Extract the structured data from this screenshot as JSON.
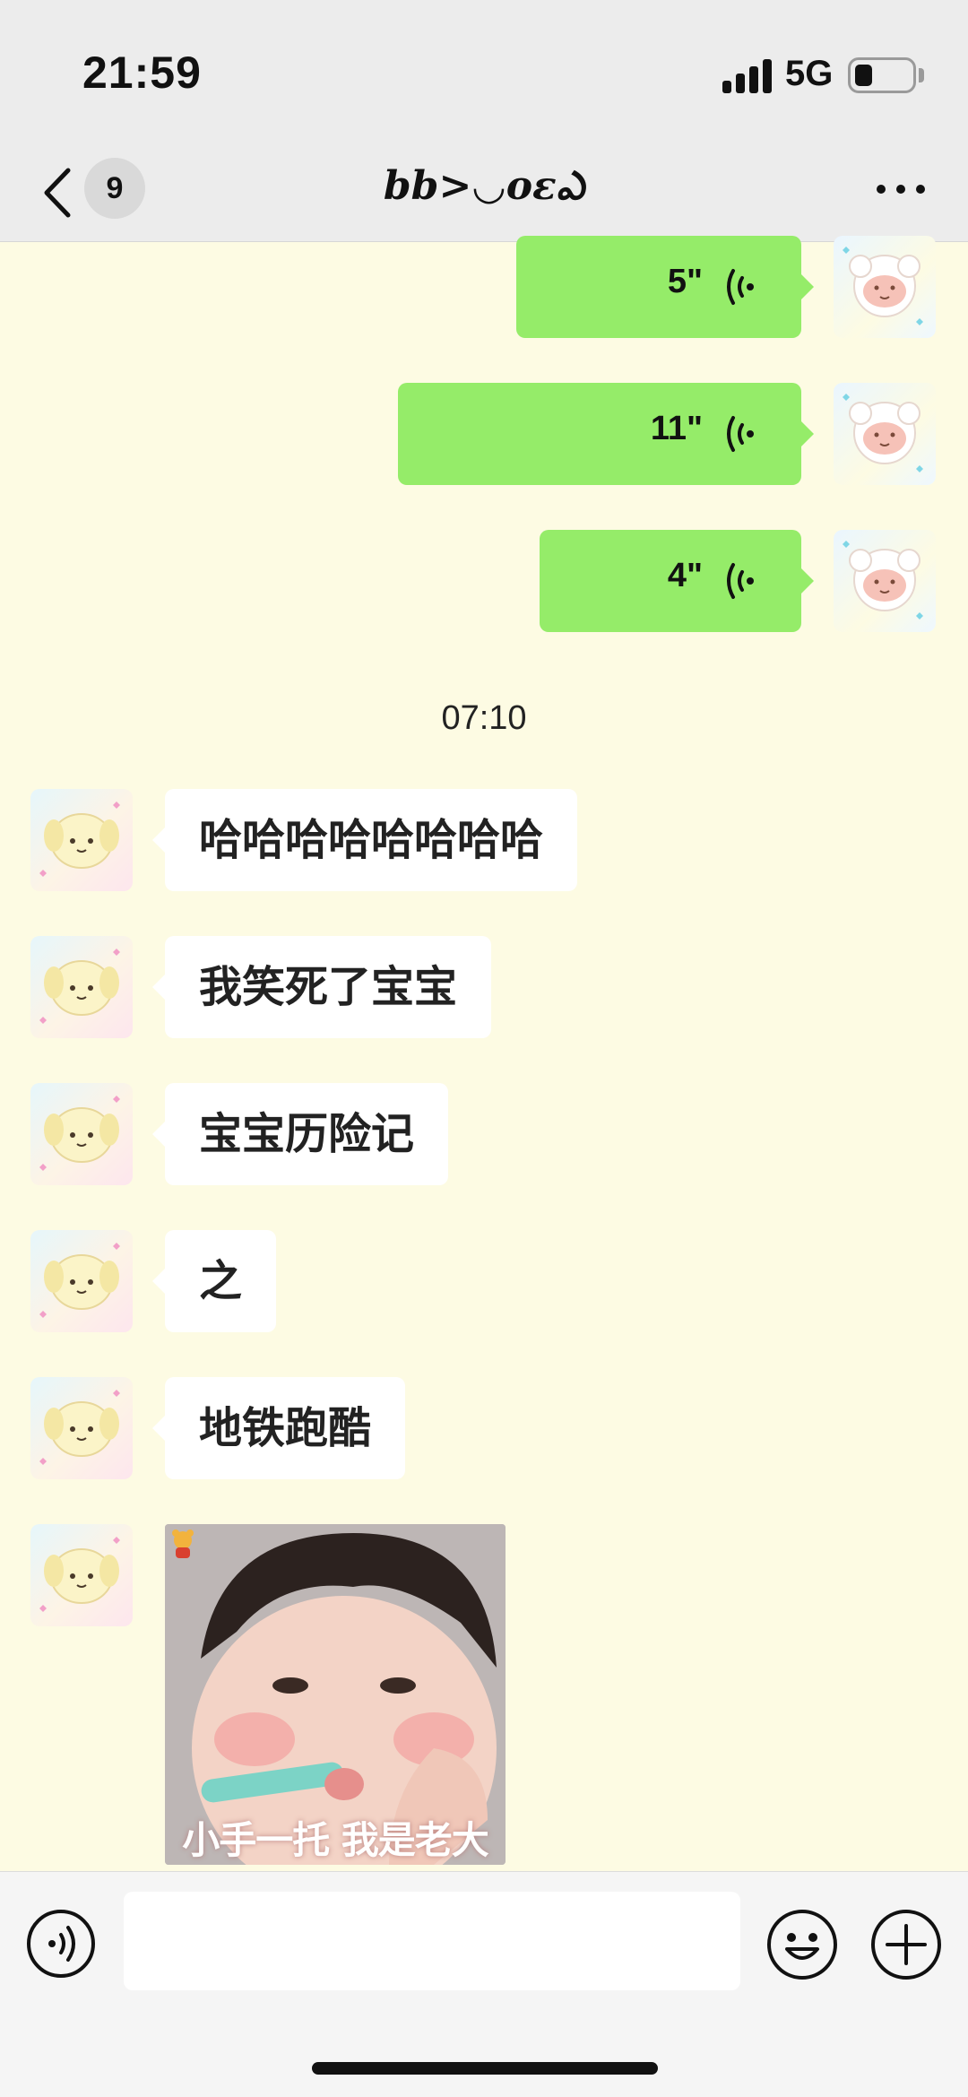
{
  "status_bar": {
    "time": "21:59",
    "network": "5G",
    "battery_level": 0.3
  },
  "nav": {
    "unread_count": "9",
    "title": "bb>◡oεఎ"
  },
  "messages": {
    "voice": [
      {
        "duration": "5\""
      },
      {
        "duration": "11\""
      },
      {
        "duration": "4\""
      }
    ],
    "timestamp": "07:10",
    "texts": [
      {
        "text": "哈哈哈哈哈哈哈哈"
      },
      {
        "text": "我笑死了宝宝"
      },
      {
        "text": "宝宝历险记"
      },
      {
        "text": "之"
      },
      {
        "text": "地铁跑酷"
      }
    ],
    "image_caption": "小手一托 我是老大"
  },
  "icons": {
    "back": "chevron-left-icon",
    "more": "more-dots-icon",
    "voice_wave": "voice-wave-icon",
    "voice_mode": "voice-mode-icon",
    "emoji": "emoji-icon",
    "plus": "plus-icon"
  },
  "colors": {
    "chat_background": "#fdfbe3",
    "sent_bubble": "#95ec69",
    "received_bubble": "#ffffff",
    "bar_background": "#ececec"
  }
}
